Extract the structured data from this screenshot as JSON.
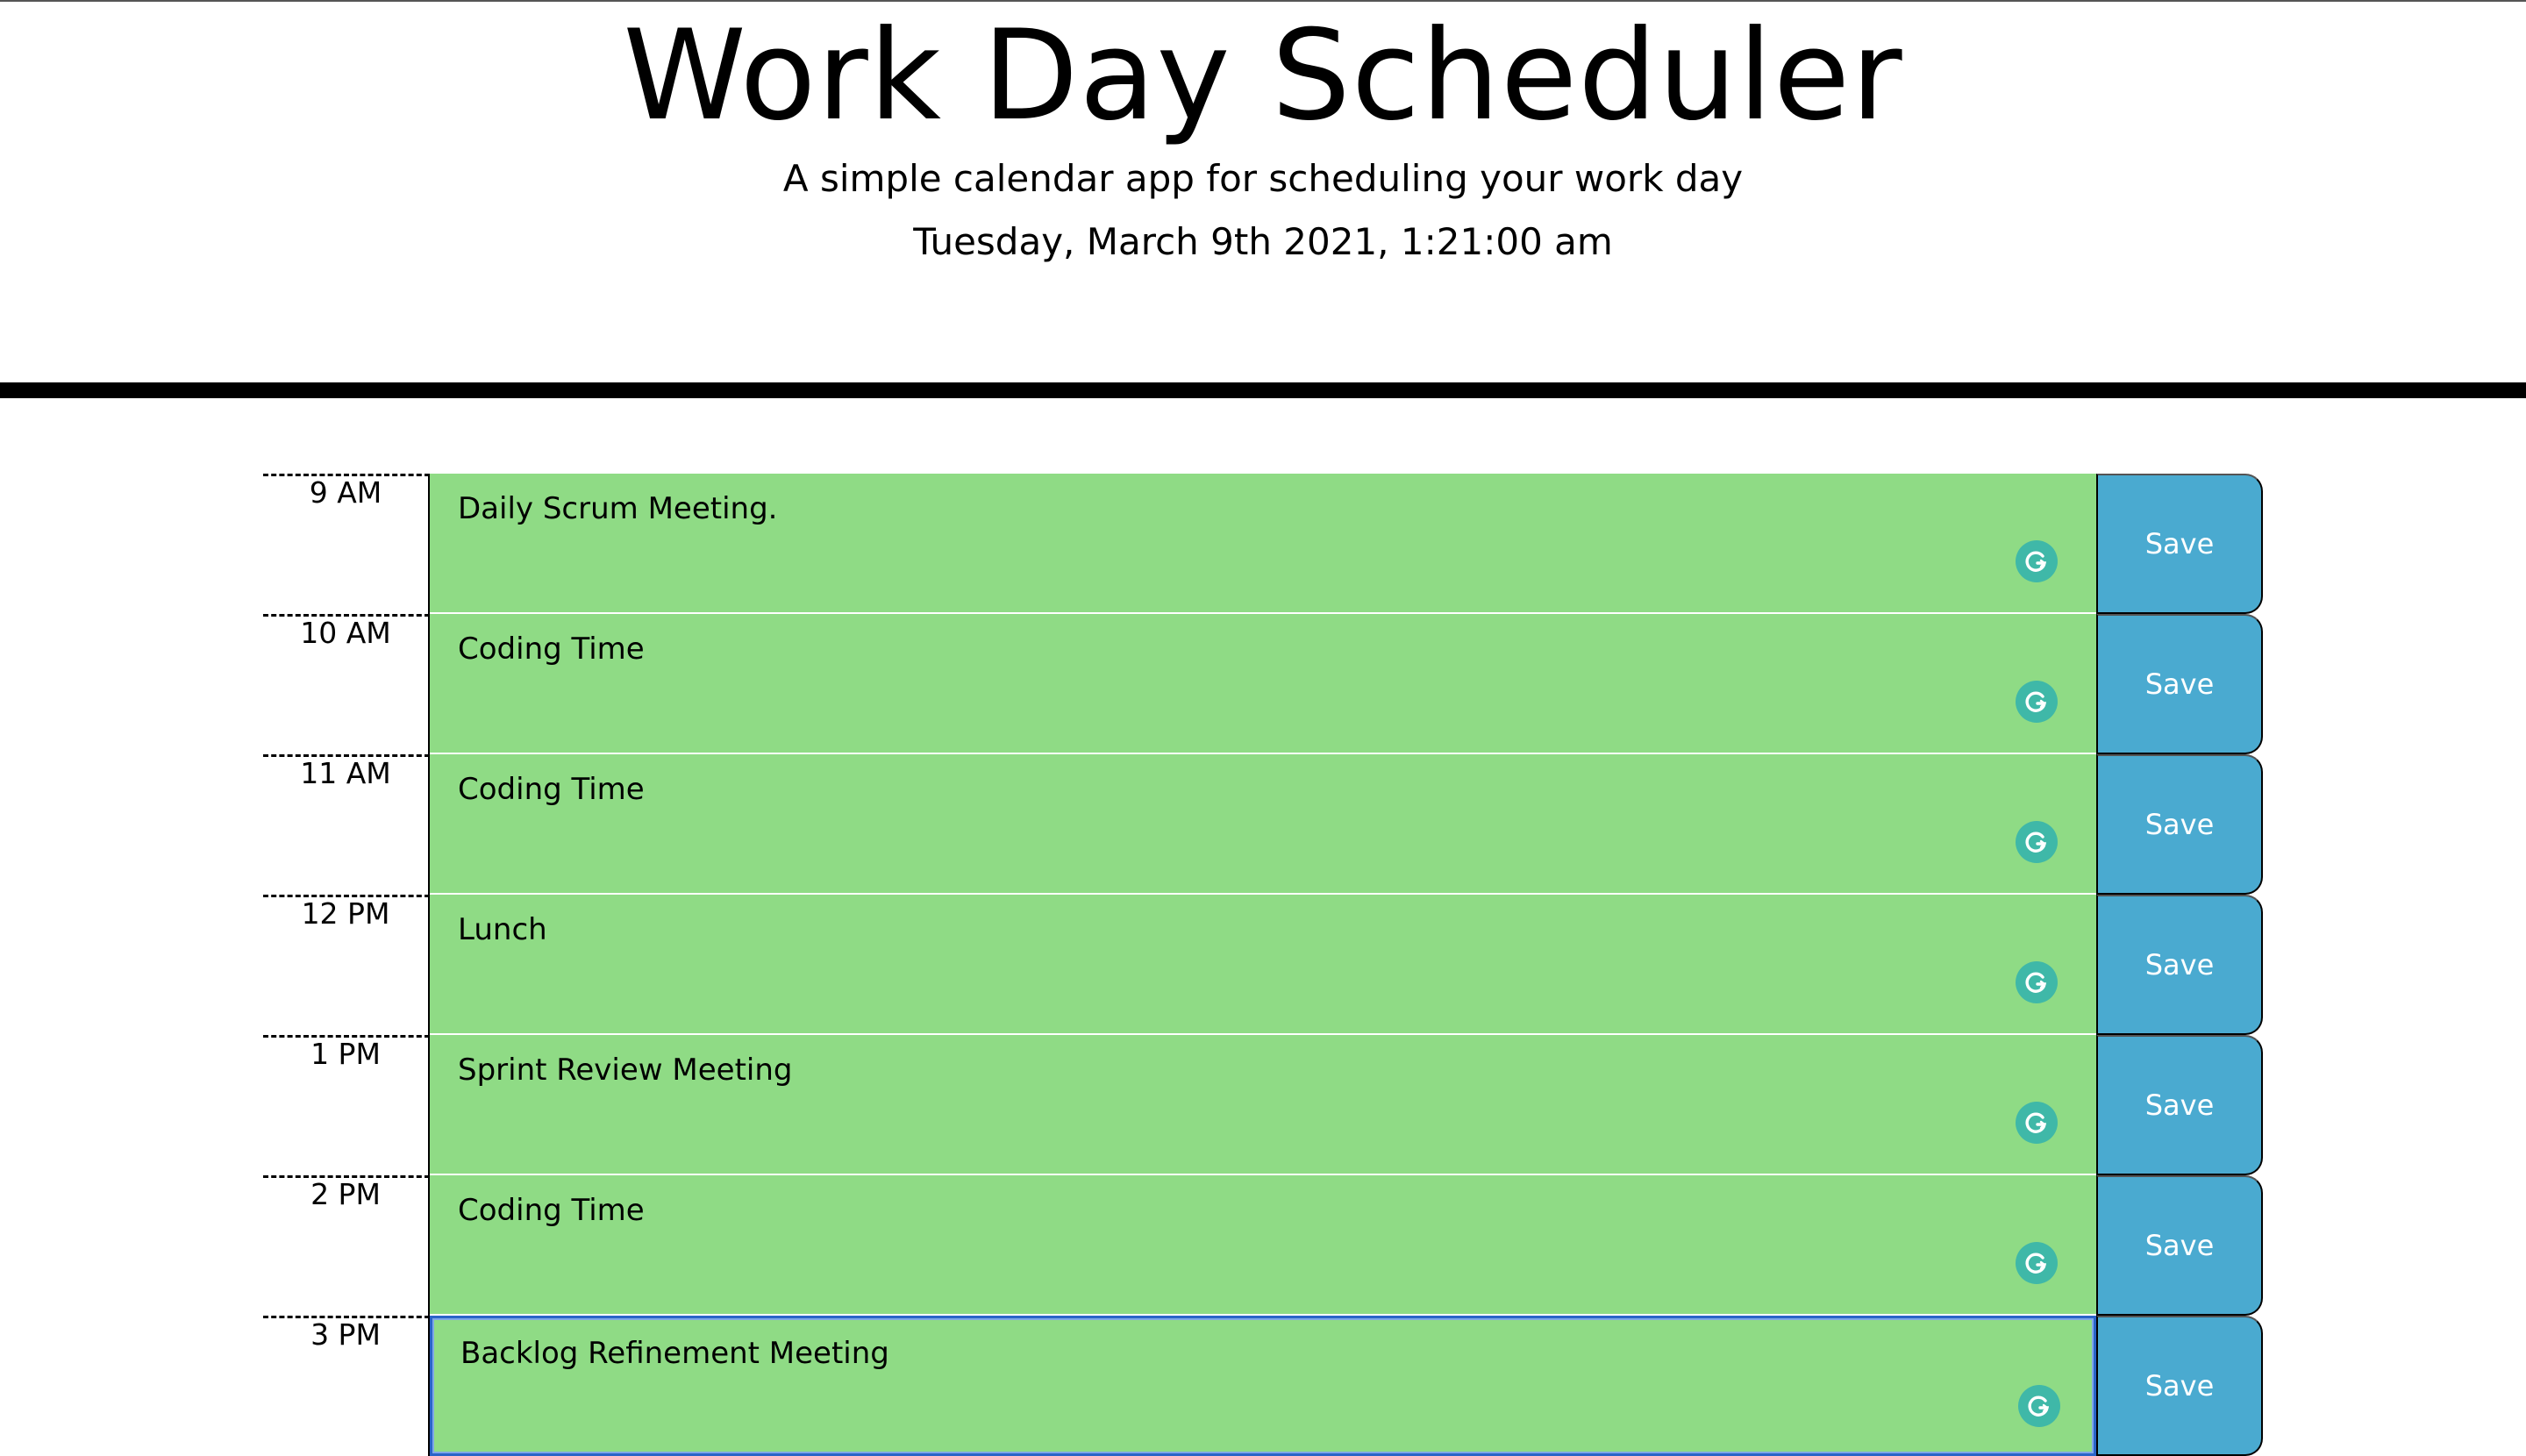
{
  "header": {
    "title": "Work Day Scheduler",
    "lead": "A simple calendar app for scheduling your work day",
    "current_day": "Tuesday, March 9th 2021, 1:21:00 am"
  },
  "rows": [
    {
      "hour": "9 AM",
      "task": "Daily Scrum Meeting.",
      "save_label": "Save",
      "status": "future"
    },
    {
      "hour": "10 AM",
      "task": "Coding Time",
      "save_label": "Save",
      "status": "future"
    },
    {
      "hour": "11 AM",
      "task": "Coding Time",
      "save_label": "Save",
      "status": "future"
    },
    {
      "hour": "12 PM",
      "task": "Lunch",
      "save_label": "Save",
      "status": "future"
    },
    {
      "hour": "1 PM",
      "task": "Sprint Review Meeting",
      "save_label": "Save",
      "status": "future"
    },
    {
      "hour": "2 PM",
      "task": "Coding Time",
      "save_label": "Save",
      "status": "future"
    },
    {
      "hour": "3 PM",
      "task": "Backlog Refinement Meeting",
      "save_label": "Save",
      "status": "future"
    }
  ],
  "icons": {
    "grammar_helper": "grammarly-icon"
  },
  "colors": {
    "future_row": "#8fdb85",
    "save_button": "#4aaad0",
    "focus_border": "#2a64c8",
    "grammar_icon": "#3fb8a8"
  }
}
